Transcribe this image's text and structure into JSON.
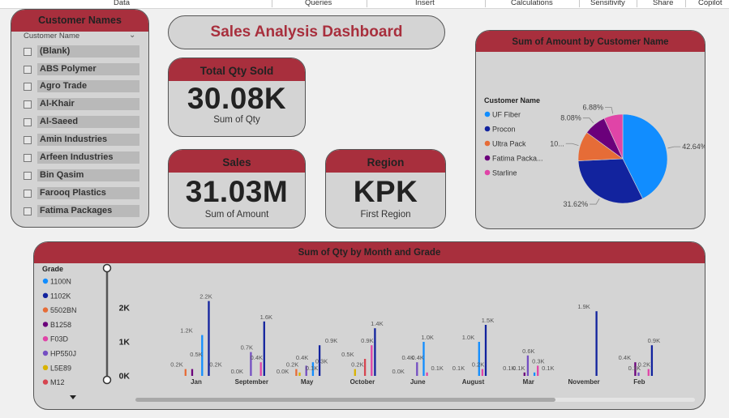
{
  "ribbon": {
    "tabs": [
      "Data",
      "Queries",
      "Insert",
      "Calculations",
      "Sensitivity",
      "Share",
      "Copilot"
    ]
  },
  "slicer": {
    "title": "Customer Names",
    "field_label": "Customer Name",
    "items": [
      "(Blank)",
      "ABS Polymer",
      "Agro Trade",
      "Al-Khair",
      "Al-Saeed",
      "Amin Industries",
      "Arfeen Industries",
      "Bin Qasim",
      "Farooq Plastics",
      "Fatima Packages"
    ]
  },
  "dashboard_title": "Sales Analysis Dashboard",
  "kpis": {
    "qty": {
      "title": "Total Qty Sold",
      "value": "30.08K",
      "sub": "Sum of Qty"
    },
    "sales": {
      "title": "Sales",
      "value": "31.03M",
      "sub": "Sum of Amount"
    },
    "region": {
      "title": "Region",
      "value": "KPK",
      "sub": "First Region"
    }
  },
  "pie_card": {
    "title": "Sum of Amount by Customer Name",
    "legend_title": "Customer Name"
  },
  "bar_card": {
    "title": "Sum of Qty by Month and Grade",
    "legend_title": "Grade"
  },
  "colors": {
    "accent": "#a82f3d",
    "card": "#d4d4d4",
    "slider": "#555555"
  },
  "chart_data": [
    {
      "type": "pie",
      "title": "Sum of Amount by Customer Name",
      "legend_title": "Customer Name",
      "categories": [
        "UF Fiber",
        "Procon",
        "Ultra Pack",
        "Fatima Packa...",
        "Starline"
      ],
      "colors": [
        "#118dff",
        "#12239e",
        "#e66c37",
        "#6b007b",
        "#e044a7"
      ],
      "values": [
        42.64,
        31.62,
        10.78,
        8.08,
        6.88
      ],
      "labels": [
        "42.64%",
        "31.62%",
        "10...",
        "8.08%",
        "6.88%"
      ]
    },
    {
      "type": "bar",
      "title": "Sum of Qty by Month and Grade",
      "legend_title": "Grade",
      "categories": [
        "Jan",
        "September",
        "May",
        "October",
        "June",
        "August",
        "Mar",
        "November",
        "Feb"
      ],
      "ylim": [
        0,
        2500
      ],
      "yticks": [
        {
          "v": 0,
          "label": "0K"
        },
        {
          "v": 1000,
          "label": "1K"
        },
        {
          "v": 2000,
          "label": "2K"
        }
      ],
      "series": [
        {
          "name": "1100N",
          "color": "#118dff",
          "values": [
            1200,
            0,
            400,
            0,
            1000,
            1000,
            100,
            0,
            0
          ]
        },
        {
          "name": "1102K",
          "color": "#12239e",
          "values": [
            2200,
            1600,
            900,
            1400,
            0,
            1500,
            0,
            1900,
            900
          ]
        },
        {
          "name": "5502BN",
          "color": "#e66c37",
          "values": [
            200,
            0,
            200,
            0,
            0,
            0,
            0,
            0,
            0
          ]
        },
        {
          "name": "B1258",
          "color": "#6b007b",
          "values": [
            200,
            0,
            0,
            0,
            0,
            0,
            100,
            0,
            400
          ]
        },
        {
          "name": "F03D",
          "color": "#e044a7",
          "values": [
            0,
            400,
            0,
            900,
            100,
            200,
            300,
            0,
            200
          ]
        },
        {
          "name": "HP550J",
          "color": "#744ec2",
          "values": [
            0,
            700,
            300,
            0,
            400,
            0,
            600,
            0,
            100
          ]
        },
        {
          "name": "L5E89",
          "color": "#d9b300",
          "values": [
            0,
            0,
            100,
            200,
            0,
            0,
            0,
            0,
            0
          ]
        },
        {
          "name": "M12",
          "color": "#d64550",
          "values": [
            0,
            0,
            0,
            500,
            0,
            0,
            0,
            0,
            0
          ]
        }
      ],
      "data_labels": [
        {
          "cat": "Jan",
          "bars": [
            {
              "label": "0.2K",
              "v": 200
            },
            {
              "label": "1.2K",
              "v": 1200
            },
            {
              "label": "0.5K",
              "v": 500
            },
            {
              "label": "2.2K",
              "v": 2200
            },
            {
              "label": "0.2K",
              "v": 200
            }
          ]
        },
        {
          "cat": "September",
          "bars": [
            {
              "label": "0.0K",
              "v": 0
            },
            {
              "label": "0.7K",
              "v": 700
            },
            {
              "label": "0.4K",
              "v": 400
            },
            {
              "label": "1.6K",
              "v": 1600
            }
          ]
        },
        {
          "cat": "May",
          "bars": [
            {
              "label": "0.0K",
              "v": 0
            },
            {
              "label": "0.2K",
              "v": 200
            },
            {
              "label": "0.4K",
              "v": 400
            },
            {
              "label": "0.1K",
              "v": 100
            },
            {
              "label": "0.3K",
              "v": 300
            },
            {
              "label": "0.9K",
              "v": 900
            }
          ]
        },
        {
          "cat": "October",
          "bars": [
            {
              "label": "0.5K",
              "v": 500
            },
            {
              "label": "0.2K",
              "v": 200
            },
            {
              "label": "0.9K",
              "v": 900
            },
            {
              "label": "1.4K",
              "v": 1400
            }
          ]
        },
        {
          "cat": "June",
          "bars": [
            {
              "label": "0.0K",
              "v": 0
            },
            {
              "label": "0.4K",
              "v": 400
            },
            {
              "label": "0.4K",
              "v": 400
            },
            {
              "label": "1.0K",
              "v": 1000
            },
            {
              "label": "0.1K",
              "v": 100
            }
          ]
        },
        {
          "cat": "August",
          "bars": [
            {
              "label": "0.1K",
              "v": 100
            },
            {
              "label": "1.0K",
              "v": 1000
            },
            {
              "label": "0.2K",
              "v": 200
            },
            {
              "label": "1.5K",
              "v": 1500
            }
          ]
        },
        {
          "cat": "Mar",
          "bars": [
            {
              "label": "0.1K",
              "v": 100
            },
            {
              "label": "0.1K",
              "v": 100
            },
            {
              "label": "0.6K",
              "v": 600
            },
            {
              "label": "0.3K",
              "v": 300
            },
            {
              "label": "0.1K",
              "v": 100
            }
          ]
        },
        {
          "cat": "November",
          "bars": [
            {
              "label": "1.9K",
              "v": 1900
            }
          ]
        },
        {
          "cat": "Feb",
          "bars": [
            {
              "label": "0.4K",
              "v": 400
            },
            {
              "label": "0.1K",
              "v": 100
            },
            {
              "label": "0.2K",
              "v": 200
            },
            {
              "label": "0.9K",
              "v": 900
            }
          ]
        }
      ]
    }
  ]
}
